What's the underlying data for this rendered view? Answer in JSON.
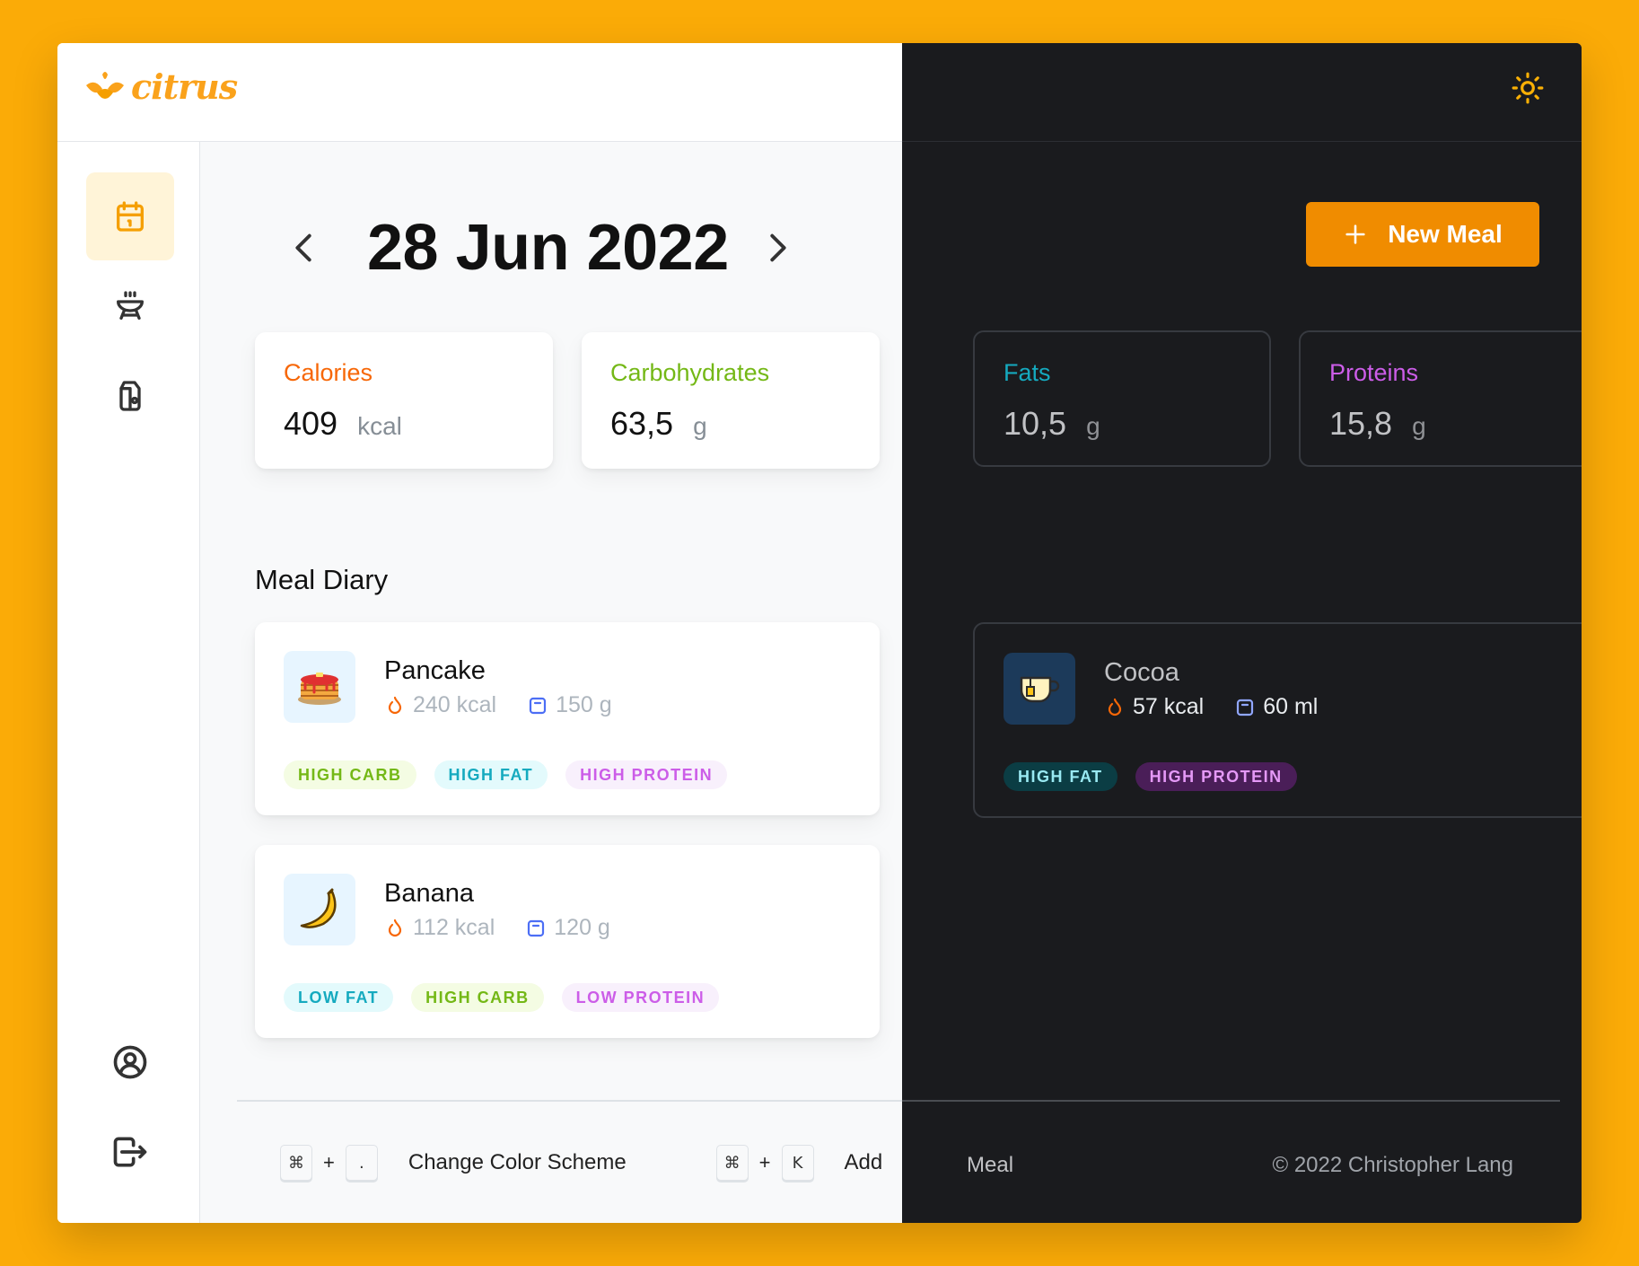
{
  "app": {
    "name": "citrus"
  },
  "date": {
    "label": "28 Jun 2022"
  },
  "actions": {
    "new_meal": "New Meal"
  },
  "stats": [
    {
      "label": "Calories",
      "value": "409",
      "unit": "kcal",
      "color": "#F76707"
    },
    {
      "label": "Carbohydrates",
      "value": "63,5",
      "unit": "g",
      "color": "#74B816"
    },
    {
      "label": "Fats",
      "value": "10,5",
      "unit": "g",
      "color": "#15AABF"
    },
    {
      "label": "Proteins",
      "value": "15,8",
      "unit": "g",
      "color": "#CC5DE8"
    }
  ],
  "diary": {
    "title": "Meal Diary",
    "meals": [
      {
        "name": "Pancake",
        "energy": "240 kcal",
        "amount": "150 g",
        "icon": "pancake-icon",
        "tags": [
          "HIGH CARB",
          "HIGH FAT",
          "HIGH PROTEIN"
        ]
      },
      {
        "name": "Banana",
        "energy": "112 kcal",
        "amount": "120 g",
        "icon": "banana-icon",
        "tags": [
          "LOW FAT",
          "HIGH CARB",
          "LOW PROTEIN"
        ]
      },
      {
        "name": "Cocoa",
        "energy": "57 kcal",
        "amount": "60 ml",
        "icon": "cocoa-cup-icon",
        "tags": [
          "HIGH FAT",
          "HIGH PROTEIN"
        ]
      }
    ]
  },
  "footer": {
    "shortcut_scheme_keys": [
      "⌘",
      "."
    ],
    "shortcut_scheme_label": "Change Color Scheme",
    "shortcut_add_keys": [
      "⌘",
      "K"
    ],
    "shortcut_add_label_light": "Add",
    "shortcut_add_label_dark": "Meal",
    "plus": "+",
    "copyright": "© 2022 Christopher Lang"
  },
  "sidebar": {
    "items": [
      {
        "icon": "calendar-icon",
        "active": true
      },
      {
        "icon": "grill-icon",
        "active": false
      },
      {
        "icon": "pantry-jar-icon",
        "active": false
      }
    ],
    "bottom": [
      {
        "icon": "user-circle-icon"
      },
      {
        "icon": "logout-icon"
      }
    ]
  },
  "theme": {
    "accent": "#F08C00",
    "brand": "#FAA21B",
    "background": "#FBAB07",
    "dark_bg": "#1A1B1E"
  }
}
